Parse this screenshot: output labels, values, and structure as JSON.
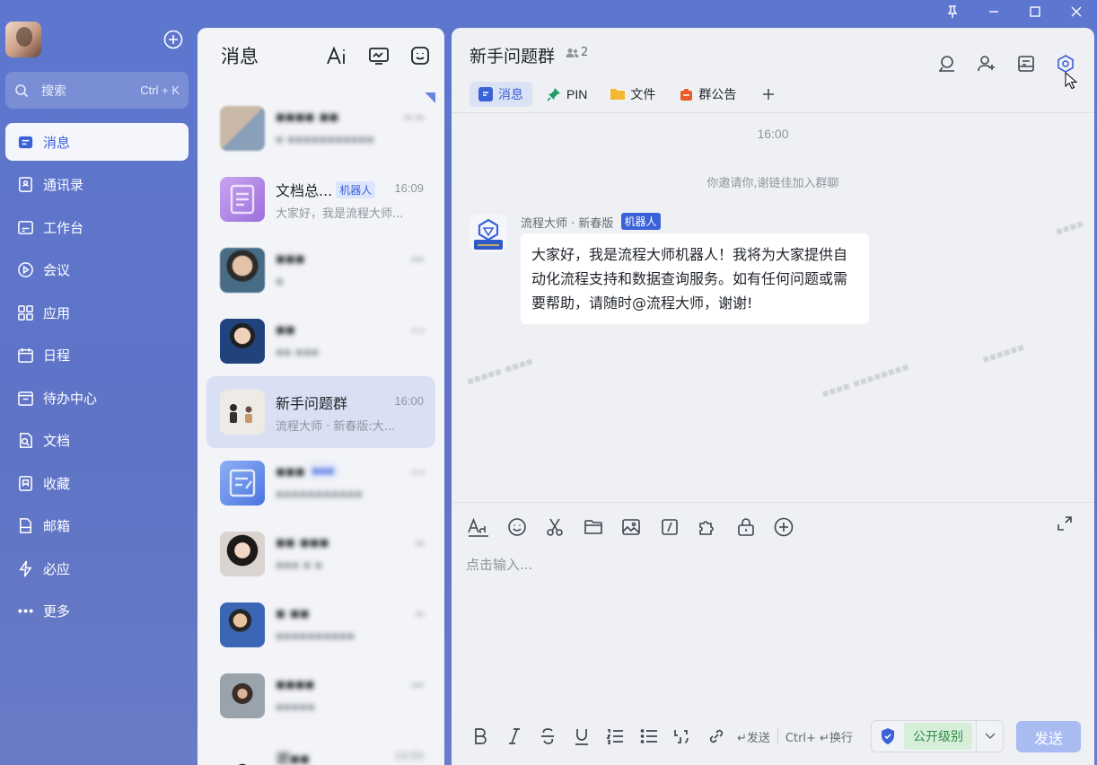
{
  "window": {
    "controls": [
      "pin-icon",
      "minimize-icon",
      "maximize-icon",
      "close-icon"
    ]
  },
  "nav": {
    "search_placeholder": "搜索",
    "search_shortcut": "Ctrl + K",
    "items": [
      {
        "label": "消息",
        "icon": "message-icon",
        "active": true
      },
      {
        "label": "通讯录",
        "icon": "contacts-icon"
      },
      {
        "label": "工作台",
        "icon": "workbench-icon"
      },
      {
        "label": "会议",
        "icon": "meeting-icon"
      },
      {
        "label": "应用",
        "icon": "apps-icon"
      },
      {
        "label": "日程",
        "icon": "calendar-icon"
      },
      {
        "label": "待办中心",
        "icon": "todo-icon"
      },
      {
        "label": "文档",
        "icon": "docs-icon"
      },
      {
        "label": "收藏",
        "icon": "favorites-icon"
      },
      {
        "label": "邮箱",
        "icon": "mail-icon"
      },
      {
        "label": "必应",
        "icon": "bolt-icon"
      },
      {
        "label": "更多",
        "icon": "more-icon"
      }
    ]
  },
  "convs": {
    "title": "消息",
    "list": [
      {
        "name": "▪▪▪▪  ▪▪",
        "time": "▪▪ ▪▪",
        "msg": "▪ ▪▪▪▪▪▪▪▪▪▪▪",
        "blur": true
      },
      {
        "name": "文档总...",
        "tag": "机器人",
        "time": "16:09",
        "msg": "大家好，我是流程大师..."
      },
      {
        "name": "▪▪▪",
        "time": "▪▪▪",
        "msg": "▪",
        "blur": true
      },
      {
        "name": "▪▪",
        "time": "▪ ▪",
        "msg": "▪▪ ▪▪▪",
        "blur": true
      },
      {
        "name": "新手问题群",
        "time": "16:00",
        "msg": "流程大师 · 新春版:大...",
        "active": true
      },
      {
        "name": "▪▪▪",
        "tag": "▪▪▪",
        "time": "▪ ▪",
        "msg": "▪▪▪▪▪▪▪▪▪▪▪",
        "blur": true
      },
      {
        "name": "▪▪ ▪▪▪",
        "time": "▪▪",
        "msg": "▪▪▪ ▪ ▪",
        "blur": true
      },
      {
        "name": "▪ ▪▪",
        "time": "▪▪",
        "msg": "▪▪▪▪▪▪▪▪▪▪",
        "blur": true
      },
      {
        "name": "▪▪▪▪",
        "time": "▪▪▪",
        "msg": "▪▪▪▪▪",
        "blur": true
      },
      {
        "name": "谢▪▪",
        "time": "14:50",
        "msg": "",
        "blur": true
      }
    ]
  },
  "chat": {
    "group_name": "新手问题群",
    "member_count": "2",
    "tabs": [
      {
        "label": "消息",
        "icon": "message-tab-icon",
        "active": true
      },
      {
        "label": "PIN",
        "icon": "pin-tab-icon"
      },
      {
        "label": "文件",
        "icon": "folder-tab-icon"
      },
      {
        "label": "群公告",
        "icon": "announcement-tab-icon"
      }
    ],
    "time_divider": "16:00",
    "system_message": "你邀请你,谢链佳加入群聊",
    "message": {
      "sender": "流程大师 · 新春版",
      "sender_tag": "机器人",
      "text": "大家好，我是流程大师机器人！我将为大家提供自动化流程支持和数据查询服务。如有任何问题或需要帮助，请随时@流程大师，谢谢!"
    },
    "composer": {
      "placeholder": "点击输入...",
      "send_hint": "↵发送",
      "newline_hint": "Ctrl+ ↵换行",
      "security_level": "公开级别",
      "send_label": "发送"
    }
  },
  "colors": {
    "accent": "#3c62d8",
    "nav_bg": "#5d76cf",
    "send_disabled": "#a9bcf1",
    "security_green": "#2e8b4b"
  }
}
